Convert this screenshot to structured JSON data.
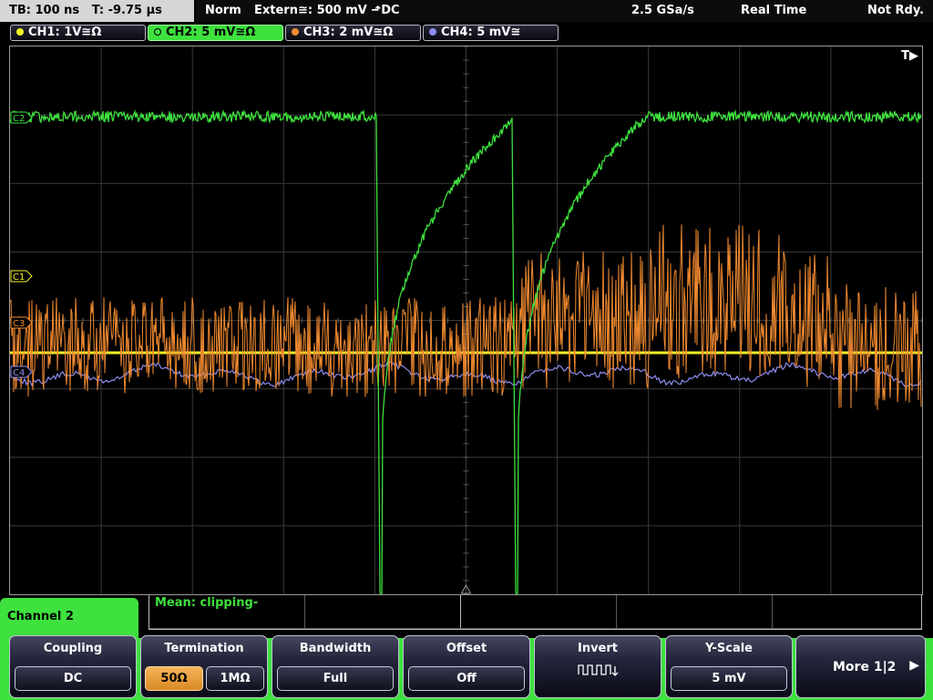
{
  "status": {
    "tb": "TB: 100 ns",
    "t": "T: -9.75 µs",
    "mode": "Norm",
    "trigger": "Extern≅: 500 mV ⬏DC",
    "sample_rate": "2.5 GSa/s",
    "acq_mode": "Real Time",
    "ready": "Not Rdy."
  },
  "channels": [
    {
      "label": "CH1: 1V≅Ω",
      "color": "#f2f228",
      "active": false
    },
    {
      "label": "CH2: 5 mV≅Ω",
      "color": "#3ee13e",
      "active": true
    },
    {
      "label": "CH3: 2 mV≅Ω",
      "color": "#f08a30",
      "active": false
    },
    {
      "label": "CH4: 5 mV≅",
      "color": "#8c8cf0",
      "active": false
    }
  ],
  "display": {
    "trigger_marker": "T▶",
    "channel_markers": [
      "C2",
      "C1",
      "C3",
      "C4"
    ],
    "grid": "10 x 8 divisions"
  },
  "measurement": {
    "text": "Mean: clipping-"
  },
  "menu": {
    "title": "Channel 2",
    "softkeys": {
      "coupling": {
        "title": "Coupling",
        "value": "DC"
      },
      "termination": {
        "title": "Termination",
        "options": [
          "50Ω",
          "1MΩ"
        ],
        "selected": "50Ω"
      },
      "bandwidth": {
        "title": "Bandwidth",
        "value": "Full"
      },
      "offset": {
        "title": "Offset",
        "value": "Off"
      },
      "invert": {
        "title": "Invert",
        "icon": "invert-pulse-icon"
      },
      "yscale": {
        "title": "Y-Scale",
        "value": "5 mV"
      },
      "more": {
        "label": "More 1|2",
        "icon": "right-arrow-icon"
      }
    }
  }
}
